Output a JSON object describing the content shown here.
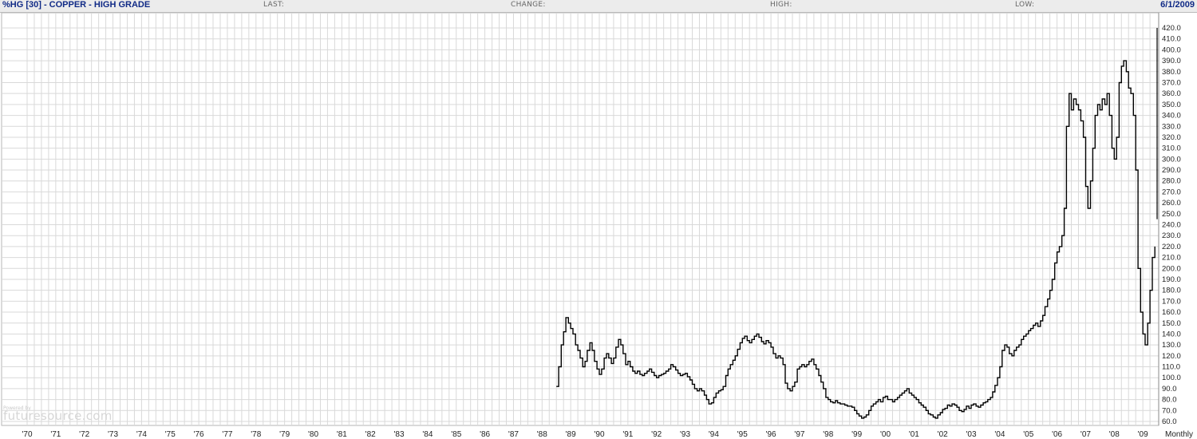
{
  "header": {
    "title": "%HG [30] - COPPER - HIGH GRADE",
    "last_label": "LAST:",
    "change_label": "CHANGE:",
    "high_label": "HIGH:",
    "low_label": "LOW:",
    "date": "6/1/2009"
  },
  "branding": {
    "small": "Powered by",
    "name": "futuresource.com"
  },
  "colors": {
    "header_text": "#102a86",
    "grid": "#d9d9d9",
    "price": "#000000",
    "background": "#ffffff"
  },
  "chart_data": {
    "type": "line",
    "title": "%HG [30] - COPPER - HIGH GRADE",
    "period_label": "Monthly",
    "x_tick_labels": [
      "'70",
      "'71",
      "'72",
      "'73",
      "'74",
      "'75",
      "'76",
      "'77",
      "'78",
      "'79",
      "'80",
      "'81",
      "'82",
      "'83",
      "'84",
      "'85",
      "'86",
      "'87",
      "'88",
      "'89",
      "'90",
      "'91",
      "'92",
      "'93",
      "'94",
      "'95",
      "'96",
      "'97",
      "'98",
      "'99",
      "'00",
      "'01",
      "'02",
      "'03",
      "'04",
      "'05",
      "'06",
      "'07",
      "'08",
      "'09"
    ],
    "xlim": [
      1970,
      2009.42
    ],
    "ylim": [
      56,
      427
    ],
    "y_ticks": [
      60,
      70,
      80,
      90,
      100,
      110,
      120,
      130,
      140,
      150,
      160,
      170,
      180,
      190,
      200,
      210,
      220,
      230,
      240,
      250,
      260,
      270,
      280,
      290,
      300,
      310,
      320,
      330,
      340,
      350,
      360,
      370,
      380,
      390,
      400,
      410,
      420
    ],
    "y_axis_side": "right",
    "grid": true,
    "series": [
      {
        "points": [
          [
            1988.5,
            92
          ],
          [
            1988.58,
            110
          ],
          [
            1988.67,
            130
          ],
          [
            1988.75,
            142
          ],
          [
            1988.83,
            155
          ],
          [
            1988.92,
            150
          ],
          [
            1989.0,
            145
          ],
          [
            1989.08,
            140
          ],
          [
            1989.17,
            130
          ],
          [
            1989.25,
            125
          ],
          [
            1989.33,
            118
          ],
          [
            1989.42,
            110
          ],
          [
            1989.5,
            115
          ],
          [
            1989.58,
            125
          ],
          [
            1989.67,
            132
          ],
          [
            1989.75,
            125
          ],
          [
            1989.83,
            115
          ],
          [
            1989.92,
            108
          ],
          [
            1990.0,
            103
          ],
          [
            1990.08,
            108
          ],
          [
            1990.17,
            118
          ],
          [
            1990.25,
            122
          ],
          [
            1990.33,
            118
          ],
          [
            1990.42,
            113
          ],
          [
            1990.5,
            118
          ],
          [
            1990.58,
            128
          ],
          [
            1990.67,
            135
          ],
          [
            1990.75,
            130
          ],
          [
            1990.83,
            122
          ],
          [
            1990.92,
            112
          ],
          [
            1991.0,
            115
          ],
          [
            1991.08,
            110
          ],
          [
            1991.17,
            106
          ],
          [
            1991.25,
            104
          ],
          [
            1991.33,
            106
          ],
          [
            1991.42,
            103
          ],
          [
            1991.5,
            102
          ],
          [
            1991.58,
            104
          ],
          [
            1991.67,
            106
          ],
          [
            1991.75,
            108
          ],
          [
            1991.83,
            105
          ],
          [
            1991.92,
            102
          ],
          [
            1992.0,
            100
          ],
          [
            1992.08,
            102
          ],
          [
            1992.17,
            103
          ],
          [
            1992.25,
            104
          ],
          [
            1992.33,
            106
          ],
          [
            1992.42,
            108
          ],
          [
            1992.5,
            112
          ],
          [
            1992.58,
            110
          ],
          [
            1992.67,
            107
          ],
          [
            1992.75,
            104
          ],
          [
            1992.83,
            102
          ],
          [
            1992.92,
            103
          ],
          [
            1993.0,
            104
          ],
          [
            1993.08,
            101
          ],
          [
            1993.17,
            98
          ],
          [
            1993.25,
            94
          ],
          [
            1993.33,
            90
          ],
          [
            1993.42,
            88
          ],
          [
            1993.5,
            90
          ],
          [
            1993.58,
            88
          ],
          [
            1993.67,
            84
          ],
          [
            1993.75,
            80
          ],
          [
            1993.83,
            76
          ],
          [
            1993.92,
            77
          ],
          [
            1994.0,
            82
          ],
          [
            1994.08,
            86
          ],
          [
            1994.17,
            88
          ],
          [
            1994.25,
            89
          ],
          [
            1994.33,
            92
          ],
          [
            1994.42,
            102
          ],
          [
            1994.5,
            108
          ],
          [
            1994.58,
            112
          ],
          [
            1994.67,
            116
          ],
          [
            1994.75,
            120
          ],
          [
            1994.83,
            126
          ],
          [
            1994.92,
            132
          ],
          [
            1995.0,
            136
          ],
          [
            1995.08,
            138
          ],
          [
            1995.17,
            134
          ],
          [
            1995.25,
            132
          ],
          [
            1995.33,
            135
          ],
          [
            1995.42,
            138
          ],
          [
            1995.5,
            140
          ],
          [
            1995.58,
            137
          ],
          [
            1995.67,
            133
          ],
          [
            1995.75,
            131
          ],
          [
            1995.83,
            134
          ],
          [
            1995.92,
            132
          ],
          [
            1996.0,
            128
          ],
          [
            1996.08,
            122
          ],
          [
            1996.17,
            118
          ],
          [
            1996.25,
            120
          ],
          [
            1996.33,
            118
          ],
          [
            1996.42,
            112
          ],
          [
            1996.5,
            95
          ],
          [
            1996.58,
            90
          ],
          [
            1996.67,
            88
          ],
          [
            1996.75,
            92
          ],
          [
            1996.83,
            96
          ],
          [
            1996.92,
            108
          ],
          [
            1997.0,
            110
          ],
          [
            1997.08,
            112
          ],
          [
            1997.17,
            110
          ],
          [
            1997.25,
            112
          ],
          [
            1997.33,
            115
          ],
          [
            1997.42,
            117
          ],
          [
            1997.5,
            112
          ],
          [
            1997.58,
            108
          ],
          [
            1997.67,
            102
          ],
          [
            1997.75,
            96
          ],
          [
            1997.83,
            90
          ],
          [
            1997.92,
            82
          ],
          [
            1998.0,
            80
          ],
          [
            1998.08,
            78
          ],
          [
            1998.17,
            77
          ],
          [
            1998.25,
            79
          ],
          [
            1998.33,
            77
          ],
          [
            1998.42,
            76
          ],
          [
            1998.5,
            76
          ],
          [
            1998.58,
            75
          ],
          [
            1998.67,
            74
          ],
          [
            1998.75,
            74
          ],
          [
            1998.83,
            73
          ],
          [
            1998.92,
            70
          ],
          [
            1999.0,
            67
          ],
          [
            1999.08,
            65
          ],
          [
            1999.17,
            63
          ],
          [
            1999.25,
            64
          ],
          [
            1999.33,
            66
          ],
          [
            1999.42,
            70
          ],
          [
            1999.5,
            74
          ],
          [
            1999.58,
            76
          ],
          [
            1999.67,
            78
          ],
          [
            1999.75,
            80
          ],
          [
            1999.83,
            78
          ],
          [
            1999.92,
            82
          ],
          [
            2000.0,
            83
          ],
          [
            2000.08,
            80
          ],
          [
            2000.17,
            80
          ],
          [
            2000.25,
            78
          ],
          [
            2000.33,
            80
          ],
          [
            2000.42,
            82
          ],
          [
            2000.5,
            84
          ],
          [
            2000.58,
            86
          ],
          [
            2000.67,
            88
          ],
          [
            2000.75,
            90
          ],
          [
            2000.83,
            86
          ],
          [
            2000.92,
            84
          ],
          [
            2001.0,
            82
          ],
          [
            2001.08,
            80
          ],
          [
            2001.17,
            77
          ],
          [
            2001.25,
            75
          ],
          [
            2001.33,
            73
          ],
          [
            2001.42,
            70
          ],
          [
            2001.5,
            67
          ],
          [
            2001.58,
            66
          ],
          [
            2001.67,
            64
          ],
          [
            2001.75,
            63
          ],
          [
            2001.83,
            66
          ],
          [
            2001.92,
            68
          ],
          [
            2002.0,
            71
          ],
          [
            2002.08,
            72
          ],
          [
            2002.17,
            75
          ],
          [
            2002.25,
            74
          ],
          [
            2002.33,
            76
          ],
          [
            2002.42,
            75
          ],
          [
            2002.5,
            73
          ],
          [
            2002.58,
            70
          ],
          [
            2002.67,
            69
          ],
          [
            2002.75,
            71
          ],
          [
            2002.83,
            74
          ],
          [
            2002.92,
            72
          ],
          [
            2003.0,
            75
          ],
          [
            2003.08,
            76
          ],
          [
            2003.17,
            74
          ],
          [
            2003.25,
            73
          ],
          [
            2003.33,
            75
          ],
          [
            2003.42,
            77
          ],
          [
            2003.5,
            78
          ],
          [
            2003.58,
            80
          ],
          [
            2003.67,
            82
          ],
          [
            2003.75,
            87
          ],
          [
            2003.83,
            93
          ],
          [
            2003.92,
            100
          ],
          [
            2004.0,
            110
          ],
          [
            2004.08,
            125
          ],
          [
            2004.17,
            130
          ],
          [
            2004.25,
            128
          ],
          [
            2004.33,
            122
          ],
          [
            2004.42,
            120
          ],
          [
            2004.5,
            125
          ],
          [
            2004.58,
            128
          ],
          [
            2004.67,
            130
          ],
          [
            2004.75,
            135
          ],
          [
            2004.83,
            138
          ],
          [
            2004.92,
            140
          ],
          [
            2005.0,
            143
          ],
          [
            2005.08,
            145
          ],
          [
            2005.17,
            148
          ],
          [
            2005.25,
            150
          ],
          [
            2005.33,
            147
          ],
          [
            2005.42,
            152
          ],
          [
            2005.5,
            157
          ],
          [
            2005.58,
            165
          ],
          [
            2005.67,
            172
          ],
          [
            2005.75,
            180
          ],
          [
            2005.83,
            190
          ],
          [
            2005.92,
            205
          ],
          [
            2006.0,
            215
          ],
          [
            2006.08,
            220
          ],
          [
            2006.17,
            230
          ],
          [
            2006.25,
            255
          ],
          [
            2006.33,
            330
          ],
          [
            2006.42,
            360
          ],
          [
            2006.5,
            345
          ],
          [
            2006.58,
            355
          ],
          [
            2006.67,
            350
          ],
          [
            2006.75,
            345
          ],
          [
            2006.83,
            335
          ],
          [
            2006.92,
            320
          ],
          [
            2007.0,
            275
          ],
          [
            2007.08,
            255
          ],
          [
            2007.17,
            280
          ],
          [
            2007.25,
            310
          ],
          [
            2007.33,
            340
          ],
          [
            2007.42,
            350
          ],
          [
            2007.5,
            345
          ],
          [
            2007.58,
            355
          ],
          [
            2007.67,
            350
          ],
          [
            2007.75,
            360
          ],
          [
            2007.83,
            340
          ],
          [
            2007.92,
            310
          ],
          [
            2008.0,
            300
          ],
          [
            2008.08,
            320
          ],
          [
            2008.17,
            370
          ],
          [
            2008.25,
            385
          ],
          [
            2008.33,
            390
          ],
          [
            2008.42,
            380
          ],
          [
            2008.5,
            365
          ],
          [
            2008.58,
            360
          ],
          [
            2008.67,
            340
          ],
          [
            2008.75,
            290
          ],
          [
            2008.83,
            200
          ],
          [
            2008.92,
            160
          ],
          [
            2009.0,
            140
          ],
          [
            2009.08,
            130
          ],
          [
            2009.17,
            150
          ],
          [
            2009.25,
            180
          ],
          [
            2009.33,
            210
          ],
          [
            2009.42,
            220
          ]
        ]
      }
    ]
  }
}
